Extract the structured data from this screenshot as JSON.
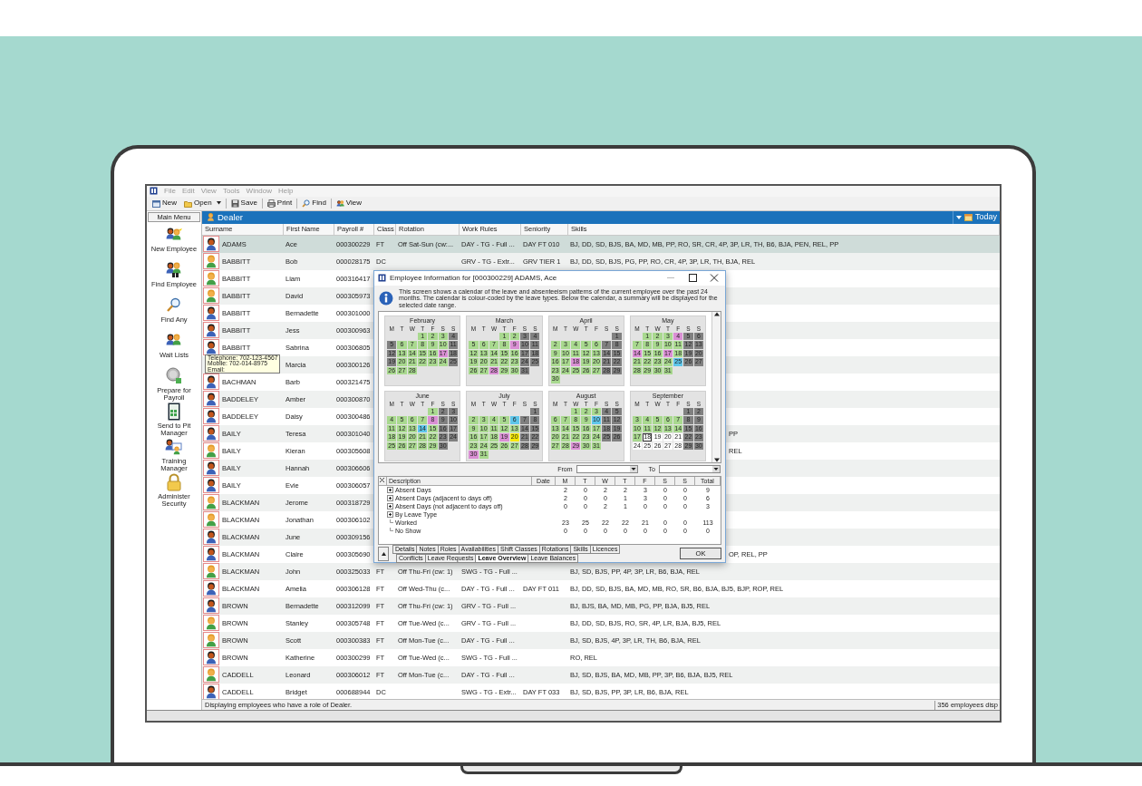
{
  "menu": [
    {
      "label": "File",
      "disabled": true
    },
    {
      "label": "Edit",
      "disabled": true
    },
    {
      "label": "View",
      "disabled": true
    },
    {
      "label": "Tools",
      "disabled": true
    },
    {
      "label": "Window",
      "disabled": true
    },
    {
      "label": "Help",
      "disabled": true
    }
  ],
  "toolbar": [
    {
      "label": "New",
      "kind": "button"
    },
    {
      "label": "Open",
      "kind": "dropdown"
    },
    {
      "label": "Save",
      "kind": "button"
    },
    {
      "label": "Print",
      "kind": "button"
    },
    {
      "label": "Find",
      "kind": "button"
    },
    {
      "label": "View",
      "kind": "button"
    }
  ],
  "sidebar": {
    "title": "Main Menu",
    "items": [
      "New Employee",
      "Find Employee",
      "Find Any",
      "Wait Lists",
      "Prepare for Payroll",
      "Send to Pit Manager",
      "Training Manager",
      "Administer Security"
    ]
  },
  "list": {
    "title": "Dealer",
    "date_label": "Today",
    "columns": [
      "Surname",
      "First Name",
      "Payroll #",
      "Class",
      "Rotation",
      "Work Rules",
      "Seniority",
      "Skills"
    ],
    "rows": [
      {
        "kind": "dark_avatar",
        "surname": "ADAMS",
        "first_name": "Ace",
        "payroll": "000300229",
        "class": "FT",
        "rotation": "Off Sat-Sun (cw:...",
        "work_rules": "DAY - TG - Full ...",
        "seniority": "DAY FT 010",
        "skills": "BJ, DD, SD, BJS, BA, MD, MB, PP, RO, SR, CR, 4P, 3P, LR, TH, B6, BJA, PEN, REL, PP",
        "selected": true
      },
      {
        "kind": "light_avatar",
        "surname": "BABBITT",
        "first_name": "Bob",
        "payroll": "000028175",
        "class": "DC",
        "work_rules": "GRV - TG - Extr...",
        "seniority": "GRV TIER 1",
        "skills": "BJ, DD, SD, BJS, PG, PP, RO, CR, 4P, 3P, LR, TH, BJA, REL",
        "selected": false
      },
      {
        "kind": "light_avatar",
        "surname": "BABBITT",
        "first_name": "Liam",
        "payroll": "000316417",
        "selected": false
      },
      {
        "kind": "light_avatar",
        "surname": "BABBITT",
        "first_name": "David",
        "payroll": "000305973",
        "selected": false
      },
      {
        "kind": "dark_avatar",
        "surname": "BABBITT",
        "first_name": "Bernadette",
        "payroll": "000301000",
        "selected": false
      },
      {
        "kind": "dark_avatar",
        "surname": "BABBITT",
        "first_name": "Jess",
        "payroll": "000300963",
        "selected": false
      },
      {
        "kind": "dark_avatar",
        "surname": "BABBITT",
        "first_name": "Sabrina",
        "payroll": "000306805",
        "selected": false
      },
      {
        "kind": "no_avatar",
        "first_name": "Marcia",
        "payroll": "000300126",
        "selected": false
      },
      {
        "kind": "dark_avatar",
        "surname": "BACHMAN",
        "first_name": "Barb",
        "payroll": "000321475",
        "selected": false
      },
      {
        "kind": "dark_avatar",
        "surname": "BADDELEY",
        "first_name": "Amber",
        "payroll": "000300870",
        "selected": false
      },
      {
        "kind": "dark_avatar",
        "surname": "BADDELEY",
        "first_name": "Daisy",
        "payroll": "000300486",
        "selected": false
      },
      {
        "kind": "dark_avatar",
        "surname": "BAILY",
        "first_name": "Teresa",
        "payroll": "000301040",
        "skills_tail": "PP",
        "selected": false
      },
      {
        "kind": "light_avatar",
        "surname": "BAILY",
        "first_name": "Kieran",
        "payroll": "000305608",
        "skills_tail": "REL",
        "selected": false
      },
      {
        "kind": "dark_avatar",
        "surname": "BAILY",
        "first_name": "Hannah",
        "payroll": "000306606",
        "selected": false
      },
      {
        "kind": "dark_avatar",
        "surname": "BAILY",
        "first_name": "Evie",
        "payroll": "000306057",
        "selected": false
      },
      {
        "kind": "light_avatar",
        "surname": "BLACKMAN",
        "first_name": "Jerome",
        "payroll": "000318729",
        "selected": false
      },
      {
        "kind": "light_avatar",
        "surname": "BLACKMAN",
        "first_name": "Jonathan",
        "payroll": "000306102",
        "selected": false
      },
      {
        "kind": "dark_avatar",
        "surname": "BLACKMAN",
        "first_name": "June",
        "payroll": "000309156",
        "selected": false
      },
      {
        "kind": "dark_avatar",
        "surname": "BLACKMAN",
        "first_name": "Claire",
        "payroll": "000305690",
        "skills_tail": "OP, REL, PP",
        "selected": false
      },
      {
        "kind": "light_avatar",
        "surname": "BLACKMAN",
        "first_name": "John",
        "payroll": "000325033",
        "class": "FT",
        "rotation": "Off Thu-Fri (cw: 1)",
        "work_rules": "SWG - TG - Full ...",
        "skills": "BJ, SD, BJS, PP, 4P, 3P, LR, B6, BJA, REL",
        "selected": false
      },
      {
        "kind": "dark_avatar",
        "surname": "BLACKMAN",
        "first_name": "Amelia",
        "payroll": "000306128",
        "class": "FT",
        "rotation": "Off Wed-Thu (c...",
        "work_rules": "DAY - TG - Full ...",
        "seniority": "DAY FT 011",
        "skills": "BJ, DD, SD, BJS, BA, MD, MB, RO, SR, B6, BJA, BJ5, BJP, ROP, REL",
        "selected": false
      },
      {
        "kind": "dark_avatar",
        "surname": "BROWN",
        "first_name": "Bernadette",
        "payroll": "000312099",
        "class": "FT",
        "rotation": "Off Thu-Fri (cw: 1)",
        "work_rules": "GRV - TG - Full ...",
        "skills": "BJ, BJS, BA, MD, MB, PG, PP, BJA, BJ5, REL",
        "selected": false
      },
      {
        "kind": "light_avatar",
        "surname": "BROWN",
        "first_name": "Stanley",
        "payroll": "000305748",
        "class": "FT",
        "rotation": "Off Tue-Wed (c...",
        "work_rules": "GRV - TG - Full ...",
        "skills": "BJ, DD, SD, BJS, RO, SR, 4P, LR, BJA, BJ5, REL",
        "selected": false
      },
      {
        "kind": "light_avatar",
        "surname": "BROWN",
        "first_name": "Scott",
        "payroll": "000300383",
        "class": "FT",
        "rotation": "Off Mon-Tue (c...",
        "work_rules": "DAY - TG - Full ...",
        "skills": "BJ, SD, BJS, 4P, 3P, LR, TH, B6, BJA, REL",
        "selected": false
      },
      {
        "kind": "dark_avatar",
        "surname": "BROWN",
        "first_name": "Katherine",
        "payroll": "000300299",
        "class": "FT",
        "rotation": "Off Tue-Wed (c...",
        "work_rules": "SWG - TG - Full ...",
        "skills": "RO, REL",
        "selected": false
      },
      {
        "kind": "light_avatar",
        "surname": "CADDELL",
        "first_name": "Leonard",
        "payroll": "000306012",
        "class": "FT",
        "rotation": "Off Mon-Tue (c...",
        "work_rules": "DAY - TG - Full ...",
        "skills": "BJ, SD, BJS, BA, MD, MB, PP, 3P, B6, BJA, BJ5, REL",
        "selected": false
      },
      {
        "kind": "dark_avatar",
        "surname": "CADDELL",
        "first_name": "Bridget",
        "payroll": "000688944",
        "class": "DC",
        "work_rules": "SWG - TG - Extr...",
        "seniority": "DAY FT 033",
        "skills": "BJ, SD, BJS, PP, 3P, LR, B6, BJA, REL",
        "selected": false
      }
    ]
  },
  "tooltip": {
    "lines": [
      "Telephone: 702-123-4567",
      "Mobile: 702-014-8975",
      "Email:"
    ]
  },
  "status_bar": {
    "message": "Displaying employees who have a role of Dealer.",
    "count": "356 employees disp"
  },
  "dialog": {
    "title": "Employee Information for [000300229] ADAMS, Ace",
    "info": "This screen shows a calendar of the leave and absenteeism patterns of the current employee over the past 24 months.  The calendar is colour-coded by the leave types. Below the calendar, a summary will be displayed for the selected date range.",
    "months": [
      {
        "name": "February",
        "weekdays": [
          "M",
          "T",
          "W",
          "T",
          "F",
          "S",
          "S"
        ],
        "weeks": [
          [
            {
              "day": "1",
              "kind": "work"
            },
            {
              "day": "2",
              "kind": "work"
            },
            {
              "day": "3",
              "kind": "work"
            },
            {
              "day": "4",
              "kind": "off"
            }
          ],
          [
            {
              "day": "5",
              "kind": "off"
            },
            {
              "day": "6",
              "kind": "work"
            },
            {
              "day": "7",
              "kind": "work"
            },
            {
              "day": "8",
              "kind": "work"
            },
            {
              "day": "9",
              "kind": "work"
            },
            {
              "day": "10",
              "kind": "work"
            },
            {
              "day": "11",
              "kind": "off"
            }
          ],
          [
            {
              "day": "12",
              "kind": "off"
            },
            {
              "day": "13",
              "kind": "work"
            },
            {
              "day": "14",
              "kind": "work"
            },
            {
              "day": "15",
              "kind": "work"
            },
            {
              "day": "16",
              "kind": "work"
            },
            {
              "day": "17",
              "kind": "absent"
            },
            {
              "day": "18",
              "kind": "off"
            }
          ],
          [
            {
              "day": "19",
              "kind": "off"
            },
            {
              "day": "20",
              "kind": "work"
            },
            {
              "day": "21",
              "kind": "work"
            },
            {
              "day": "22",
              "kind": "work"
            },
            {
              "day": "23",
              "kind": "work"
            },
            {
              "day": "24",
              "kind": "work"
            },
            {
              "day": "25",
              "kind": "off"
            }
          ],
          [
            {
              "day": "26",
              "kind": "work"
            },
            {
              "day": "27",
              "kind": "work"
            },
            {
              "day": "28",
              "kind": "work"
            }
          ]
        ]
      },
      {
        "name": "March",
        "weekdays": [
          "M",
          "T",
          "W",
          "T",
          "F",
          "S",
          "S"
        ],
        "weeks": [
          [
            {
              "day": "1",
              "kind": "work"
            },
            {
              "day": "2",
              "kind": "work"
            },
            {
              "day": "3",
              "kind": "off"
            },
            {
              "day": "4",
              "kind": "off"
            }
          ],
          [
            {
              "day": "5",
              "kind": "work"
            },
            {
              "day": "6",
              "kind": "work"
            },
            {
              "day": "7",
              "kind": "work"
            },
            {
              "day": "8",
              "kind": "work"
            },
            {
              "day": "9",
              "kind": "absent"
            },
            {
              "day": "10",
              "kind": "off"
            },
            {
              "day": "11",
              "kind": "off"
            }
          ],
          [
            {
              "day": "12",
              "kind": "work"
            },
            {
              "day": "13",
              "kind": "work"
            },
            {
              "day": "14",
              "kind": "work"
            },
            {
              "day": "15",
              "kind": "work"
            },
            {
              "day": "16",
              "kind": "work"
            },
            {
              "day": "17",
              "kind": "off"
            },
            {
              "day": "18",
              "kind": "off"
            }
          ],
          [
            {
              "day": "19",
              "kind": "work"
            },
            {
              "day": "20",
              "kind": "work"
            },
            {
              "day": "21",
              "kind": "work"
            },
            {
              "day": "22",
              "kind": "work"
            },
            {
              "day": "23",
              "kind": "work"
            },
            {
              "day": "24",
              "kind": "off"
            },
            {
              "day": "25",
              "kind": "off"
            }
          ],
          [
            {
              "day": "26",
              "kind": "work"
            },
            {
              "day": "27",
              "kind": "work"
            },
            {
              "day": "28",
              "kind": "absent"
            },
            {
              "day": "29",
              "kind": "work"
            },
            {
              "day": "30",
              "kind": "work"
            },
            {
              "day": "31",
              "kind": "off"
            }
          ]
        ]
      },
      {
        "name": "April",
        "weekdays": [
          "M",
          "T",
          "W",
          "T",
          "F",
          "S",
          "S"
        ],
        "weeks": [
          [
            {
              "day": "1",
              "kind": "off"
            }
          ],
          [
            {
              "day": "2",
              "kind": "work"
            },
            {
              "day": "3",
              "kind": "work"
            },
            {
              "day": "4",
              "kind": "work"
            },
            {
              "day": "5",
              "kind": "work"
            },
            {
              "day": "6",
              "kind": "work"
            },
            {
              "day": "7",
              "kind": "off"
            },
            {
              "day": "8",
              "kind": "off"
            }
          ],
          [
            {
              "day": "9",
              "kind": "work"
            },
            {
              "day": "10",
              "kind": "work"
            },
            {
              "day": "11",
              "kind": "work"
            },
            {
              "day": "12",
              "kind": "work"
            },
            {
              "day": "13",
              "kind": "work"
            },
            {
              "day": "14",
              "kind": "off"
            },
            {
              "day": "15",
              "kind": "off"
            }
          ],
          [
            {
              "day": "16",
              "kind": "work"
            },
            {
              "day": "17",
              "kind": "work"
            },
            {
              "day": "18",
              "kind": "absent"
            },
            {
              "day": "19",
              "kind": "work"
            },
            {
              "day": "20",
              "kind": "work"
            },
            {
              "day": "21",
              "kind": "off"
            },
            {
              "day": "22",
              "kind": "off"
            }
          ],
          [
            {
              "day": "23",
              "kind": "work"
            },
            {
              "day": "24",
              "kind": "work"
            },
            {
              "day": "25",
              "kind": "work"
            },
            {
              "day": "26",
              "kind": "work"
            },
            {
              "day": "27",
              "kind": "work"
            },
            {
              "day": "28",
              "kind": "off"
            },
            {
              "day": "29",
              "kind": "off"
            }
          ],
          [
            {
              "day": "30",
              "kind": "work"
            }
          ]
        ]
      },
      {
        "name": "May",
        "weekdays": [
          "M",
          "T",
          "W",
          "T",
          "F",
          "S",
          "S"
        ],
        "weeks": [
          [
            {
              "day": "1",
              "kind": "work"
            },
            {
              "day": "2",
              "kind": "work"
            },
            {
              "day": "3",
              "kind": "work"
            },
            {
              "day": "4",
              "kind": "absent"
            },
            {
              "day": "5",
              "kind": "off"
            },
            {
              "day": "6",
              "kind": "off"
            }
          ],
          [
            {
              "day": "7",
              "kind": "work"
            },
            {
              "day": "8",
              "kind": "work"
            },
            {
              "day": "9",
              "kind": "work"
            },
            {
              "day": "10",
              "kind": "work"
            },
            {
              "day": "11",
              "kind": "work"
            },
            {
              "day": "12",
              "kind": "off"
            },
            {
              "day": "13",
              "kind": "off"
            }
          ],
          [
            {
              "day": "14",
              "kind": "absent"
            },
            {
              "day": "15",
              "kind": "work"
            },
            {
              "day": "16",
              "kind": "work"
            },
            {
              "day": "17",
              "kind": "absent"
            },
            {
              "day": "18",
              "kind": "work"
            },
            {
              "day": "19",
              "kind": "off"
            },
            {
              "day": "20",
              "kind": "off"
            }
          ],
          [
            {
              "day": "21",
              "kind": "work"
            },
            {
              "day": "22",
              "kind": "work"
            },
            {
              "day": "23",
              "kind": "work"
            },
            {
              "day": "24",
              "kind": "work"
            },
            {
              "day": "25",
              "kind": "leave"
            },
            {
              "day": "26",
              "kind": "off"
            },
            {
              "day": "27",
              "kind": "off"
            }
          ],
          [
            {
              "day": "28",
              "kind": "work"
            },
            {
              "day": "29",
              "kind": "work"
            },
            {
              "day": "30",
              "kind": "work"
            },
            {
              "day": "31",
              "kind": "work"
            }
          ]
        ]
      },
      {
        "name": "June",
        "weekdays": [
          "M",
          "T",
          "W",
          "T",
          "F",
          "S",
          "S"
        ],
        "weeks": [
          [
            {
              "day": "1",
              "kind": "work"
            },
            {
              "day": "2",
              "kind": "off"
            },
            {
              "day": "3",
              "kind": "off"
            }
          ],
          [
            {
              "day": "4",
              "kind": "work"
            },
            {
              "day": "5",
              "kind": "work"
            },
            {
              "day": "6",
              "kind": "work"
            },
            {
              "day": "7",
              "kind": "work"
            },
            {
              "day": "8",
              "kind": "absent"
            },
            {
              "day": "9",
              "kind": "off"
            },
            {
              "day": "10",
              "kind": "off"
            }
          ],
          [
            {
              "day": "11",
              "kind": "work"
            },
            {
              "day": "12",
              "kind": "work"
            },
            {
              "day": "13",
              "kind": "work"
            },
            {
              "day": "14",
              "kind": "leave"
            },
            {
              "day": "15",
              "kind": "work"
            },
            {
              "day": "16",
              "kind": "off"
            },
            {
              "day": "17",
              "kind": "off"
            }
          ],
          [
            {
              "day": "18",
              "kind": "work"
            },
            {
              "day": "19",
              "kind": "work"
            },
            {
              "day": "20",
              "kind": "work"
            },
            {
              "day": "21",
              "kind": "work"
            },
            {
              "day": "22",
              "kind": "work"
            },
            {
              "day": "23",
              "kind": "off"
            },
            {
              "day": "24",
              "kind": "off"
            }
          ],
          [
            {
              "day": "25",
              "kind": "work"
            },
            {
              "day": "26",
              "kind": "work"
            },
            {
              "day": "27",
              "kind": "work"
            },
            {
              "day": "28",
              "kind": "work"
            },
            {
              "day": "29",
              "kind": "work"
            },
            {
              "day": "30",
              "kind": "off"
            }
          ]
        ]
      },
      {
        "name": "July",
        "weekdays": [
          "M",
          "T",
          "W",
          "T",
          "F",
          "S",
          "S"
        ],
        "weeks": [
          [
            {
              "day": "1",
              "kind": "off"
            }
          ],
          [
            {
              "day": "2",
              "kind": "work"
            },
            {
              "day": "3",
              "kind": "work"
            },
            {
              "day": "4",
              "kind": "work"
            },
            {
              "day": "5",
              "kind": "work"
            },
            {
              "day": "6",
              "kind": "leave"
            },
            {
              "day": "7",
              "kind": "off"
            },
            {
              "day": "8",
              "kind": "off"
            }
          ],
          [
            {
              "day": "9",
              "kind": "work"
            },
            {
              "day": "10",
              "kind": "work"
            },
            {
              "day": "11",
              "kind": "work"
            },
            {
              "day": "12",
              "kind": "work"
            },
            {
              "day": "13",
              "kind": "work"
            },
            {
              "day": "14",
              "kind": "off"
            },
            {
              "day": "15",
              "kind": "off"
            }
          ],
          [
            {
              "day": "16",
              "kind": "work"
            },
            {
              "day": "17",
              "kind": "work"
            },
            {
              "day": "18",
              "kind": "work"
            },
            {
              "day": "19",
              "kind": "absent"
            },
            {
              "day": "20",
              "kind": "special"
            },
            {
              "day": "21",
              "kind": "off"
            },
            {
              "day": "22",
              "kind": "off"
            }
          ],
          [
            {
              "day": "23",
              "kind": "work"
            },
            {
              "day": "24",
              "kind": "work"
            },
            {
              "day": "25",
              "kind": "work"
            },
            {
              "day": "26",
              "kind": "work"
            },
            {
              "day": "27",
              "kind": "work"
            },
            {
              "day": "28",
              "kind": "off"
            },
            {
              "day": "29",
              "kind": "off"
            }
          ],
          [
            {
              "day": "30",
              "kind": "absent"
            },
            {
              "day": "31",
              "kind": "work"
            }
          ]
        ]
      },
      {
        "name": "August",
        "weekdays": [
          "M",
          "T",
          "W",
          "T",
          "F",
          "S",
          "S"
        ],
        "weeks": [
          [
            {
              "day": "1",
              "kind": "work"
            },
            {
              "day": "2",
              "kind": "work"
            },
            {
              "day": "3",
              "kind": "work"
            },
            {
              "day": "4",
              "kind": "off"
            },
            {
              "day": "5",
              "kind": "off"
            }
          ],
          [
            {
              "day": "6",
              "kind": "work"
            },
            {
              "day": "7",
              "kind": "work"
            },
            {
              "day": "8",
              "kind": "work"
            },
            {
              "day": "9",
              "kind": "work"
            },
            {
              "day": "10",
              "kind": "leave"
            },
            {
              "day": "11",
              "kind": "off"
            },
            {
              "day": "12",
              "kind": "off"
            }
          ],
          [
            {
              "day": "13",
              "kind": "work"
            },
            {
              "day": "14",
              "kind": "work"
            },
            {
              "day": "15",
              "kind": "work"
            },
            {
              "day": "16",
              "kind": "work"
            },
            {
              "day": "17",
              "kind": "work"
            },
            {
              "day": "18",
              "kind": "off"
            },
            {
              "day": "19",
              "kind": "off"
            }
          ],
          [
            {
              "day": "20",
              "kind": "work"
            },
            {
              "day": "21",
              "kind": "work"
            },
            {
              "day": "22",
              "kind": "work"
            },
            {
              "day": "23",
              "kind": "work"
            },
            {
              "day": "24",
              "kind": "work"
            },
            {
              "day": "25",
              "kind": "off"
            },
            {
              "day": "26",
              "kind": "off"
            }
          ],
          [
            {
              "day": "27",
              "kind": "work"
            },
            {
              "day": "28",
              "kind": "work"
            },
            {
              "day": "29",
              "kind": "absent"
            },
            {
              "day": "30",
              "kind": "work"
            },
            {
              "day": "31",
              "kind": "work"
            }
          ]
        ]
      },
      {
        "name": "September",
        "weekdays": [
          "M",
          "T",
          "W",
          "T",
          "F",
          "S",
          "S"
        ],
        "weeks": [
          [
            {
              "day": "1",
              "kind": "off"
            },
            {
              "day": "2",
              "kind": "off"
            }
          ],
          [
            {
              "day": "3",
              "kind": "work"
            },
            {
              "day": "4",
              "kind": "work"
            },
            {
              "day": "5",
              "kind": "work"
            },
            {
              "day": "6",
              "kind": "work"
            },
            {
              "day": "7",
              "kind": "work"
            },
            {
              "day": "8",
              "kind": "off"
            },
            {
              "day": "9",
              "kind": "off"
            }
          ],
          [
            {
              "day": "10",
              "kind": "work"
            },
            {
              "day": "11",
              "kind": "work"
            },
            {
              "day": "12",
              "kind": "work"
            },
            {
              "day": "13",
              "kind": "work"
            },
            {
              "day": "14",
              "kind": "work"
            },
            {
              "day": "15",
              "kind": "off"
            },
            {
              "day": "16",
              "kind": "off"
            }
          ],
          [
            {
              "day": "17",
              "kind": "work"
            },
            {
              "day": "18",
              "kind": "today"
            },
            {
              "day": "19",
              "kind": "future"
            },
            {
              "day": "20",
              "kind": "future"
            },
            {
              "day": "21",
              "kind": "future"
            },
            {
              "day": "22",
              "kind": "off"
            },
            {
              "day": "23",
              "kind": "off"
            }
          ],
          [
            {
              "day": "24",
              "kind": "future"
            },
            {
              "day": "25",
              "kind": "future"
            },
            {
              "day": "26",
              "kind": "future"
            },
            {
              "day": "27",
              "kind": "future"
            },
            {
              "day": "28",
              "kind": "future"
            },
            {
              "day": "29",
              "kind": "off"
            },
            {
              "day": "30",
              "kind": "off"
            }
          ]
        ]
      }
    ],
    "from_label": "From",
    "to_label": "To",
    "summary": {
      "columns": [
        "Description",
        "Date",
        "M",
        "T",
        "W",
        "T",
        "F",
        "S",
        "S",
        "Total"
      ],
      "rows": [
        {
          "description": "Absent Days",
          "kind": "group",
          "values": [
            "2",
            "0",
            "2",
            "2",
            "3",
            "0",
            "0",
            "9"
          ]
        },
        {
          "description": "Absent Days (adjacent to days off)",
          "kind": "group",
          "values": [
            "2",
            "0",
            "0",
            "1",
            "3",
            "0",
            "0",
            "6"
          ]
        },
        {
          "description": "Absent Days (not adjacent to days off)",
          "kind": "group",
          "values": [
            "0",
            "0",
            "2",
            "1",
            "0",
            "0",
            "0",
            "3"
          ]
        },
        {
          "description": "By Leave Type",
          "kind": "group"
        },
        {
          "description": "Worked",
          "kind": "leaf",
          "values": [
            "23",
            "25",
            "22",
            "22",
            "21",
            "0",
            "0",
            "113"
          ]
        },
        {
          "description": "No Show",
          "kind": "leaf",
          "values": [
            "0",
            "0",
            "0",
            "0",
            "0",
            "0",
            "0",
            "0"
          ]
        }
      ]
    },
    "tab_rows": [
      {
        "tabs": [
          {
            "label": "Details",
            "selected": false
          },
          {
            "label": "Notes",
            "selected": false
          },
          {
            "label": "Roles",
            "selected": false
          },
          {
            "label": "Availabilities",
            "selected": false
          },
          {
            "label": "Shift Classes",
            "selected": false
          },
          {
            "label": "Rotations",
            "selected": false
          },
          {
            "label": "Skills",
            "selected": false
          },
          {
            "label": "Licences",
            "selected": false
          }
        ]
      },
      {
        "tabs": [
          {
            "label": "Conflicts",
            "selected": false
          },
          {
            "label": "Leave Requests",
            "selected": false
          },
          {
            "label": "Leave Overview",
            "selected": true
          },
          {
            "label": "Leave Balances",
            "selected": false
          }
        ]
      }
    ],
    "ok_label": "OK"
  }
}
